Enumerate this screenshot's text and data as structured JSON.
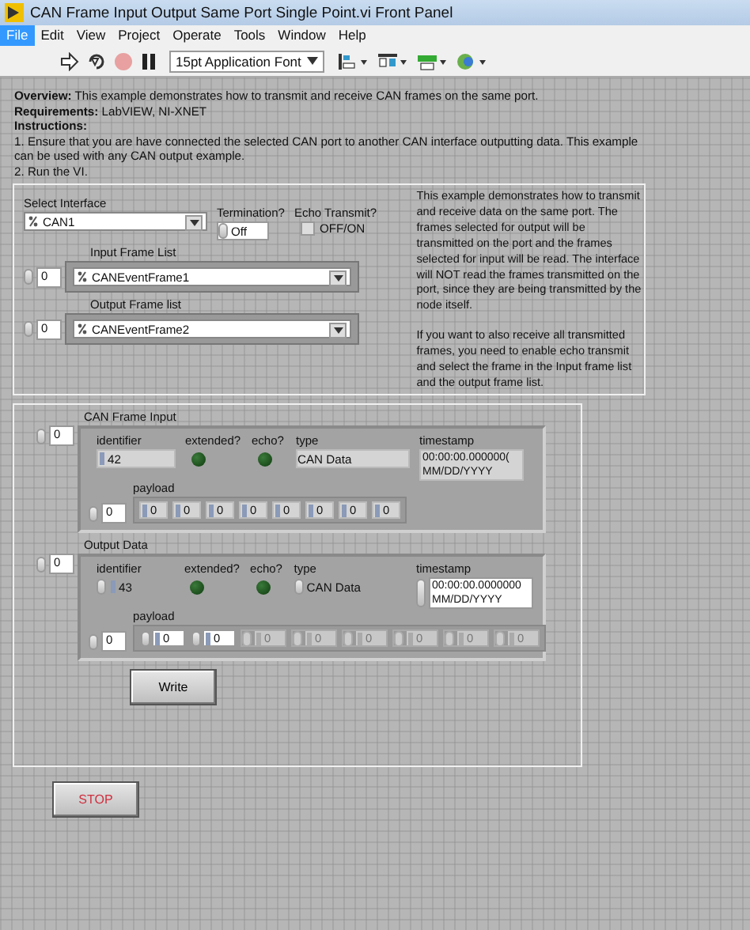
{
  "window": {
    "title": "CAN Frame Input Output Same Port Single Point.vi Front Panel"
  },
  "menu": [
    {
      "label": "File",
      "selected": true
    },
    {
      "label": "Edit",
      "selected": false
    },
    {
      "label": "View",
      "selected": false
    },
    {
      "label": "Project",
      "selected": false
    },
    {
      "label": "Operate",
      "selected": false
    },
    {
      "label": "Tools",
      "selected": false
    },
    {
      "label": "Window",
      "selected": false
    },
    {
      "label": "Help",
      "selected": false
    }
  ],
  "toolbar": {
    "font_select": "15pt Application Font"
  },
  "description": [
    "**Overview:** This example demonstrates how to transmit and receive CAN frames on the same port.",
    "**Requirements:** LabVIEW, NI-XNET",
    "**Instructions:**",
    "1. Ensure that you are have connected the selected CAN port to another CAN interface outputting data. This example can be used with any CAN output example.",
    "2.  Run the VI."
  ],
  "config": {
    "select_interface": {
      "label": "Select Interface",
      "value": "CAN1"
    },
    "termination": {
      "label": "Termination?",
      "value": "Off"
    },
    "echo_transmit": {
      "label": "Echo Transmit?",
      "checkbox_label": "OFF/ON",
      "checked": false
    },
    "frame_lists": [
      {
        "label": "Input Frame List",
        "index": "0",
        "value": "CANEventFrame1"
      },
      {
        "label": "Output Frame list",
        "index": "0",
        "value": "CANEventFrame2"
      }
    ],
    "note": [
      "This example demonstrates how to transmit and receive data on the same port.  The frames selected for output will be transmitted on the port and the frames selected for input will be read.  The interface will NOT read the frames transmitted on the port, since they are being transmitted by the node itself.",
      "If you want to also receive all transmitted frames, you need to enable echo transmit and select the frame in the Input frame list and the output frame list."
    ]
  },
  "frames": [
    {
      "kind": "indicator",
      "label": "CAN Frame Input",
      "index": "0",
      "identifier_label": "identifier",
      "identifier": "42",
      "extended_label": "extended?",
      "extended_on": false,
      "echo_label": "echo?",
      "echo_on": false,
      "type_label": "type",
      "type": "CAN Data",
      "timestamp_label": "timestamp",
      "timestamp": [
        "00:00:00.000000(",
        "MM/DD/YYYY"
      ],
      "payload_label": "payload",
      "payload_index": "0",
      "payload": [
        {
          "value": "0",
          "disabled": false
        },
        {
          "value": "0",
          "disabled": false
        },
        {
          "value": "0",
          "disabled": false
        },
        {
          "value": "0",
          "disabled": false
        },
        {
          "value": "0",
          "disabled": false
        },
        {
          "value": "0",
          "disabled": false
        },
        {
          "value": "0",
          "disabled": false
        },
        {
          "value": "0",
          "disabled": false
        }
      ]
    },
    {
      "kind": "control",
      "label": "Output Data",
      "index": "0",
      "identifier_label": "identifier",
      "identifier": "43",
      "extended_label": "extended?",
      "extended_on": false,
      "echo_label": "echo?",
      "echo_on": false,
      "type_label": "type",
      "type": "CAN Data",
      "timestamp_label": "timestamp",
      "timestamp": [
        "00:00:00.0000000",
        "MM/DD/YYYY"
      ],
      "payload_label": "payload",
      "payload_index": "0",
      "payload": [
        {
          "value": "0",
          "disabled": false
        },
        {
          "value": "0",
          "disabled": false
        },
        {
          "value": "0",
          "disabled": true
        },
        {
          "value": "0",
          "disabled": true
        },
        {
          "value": "0",
          "disabled": true
        },
        {
          "value": "0",
          "disabled": true
        },
        {
          "value": "0",
          "disabled": true
        },
        {
          "value": "0",
          "disabled": true
        }
      ]
    }
  ],
  "write_button": "Write",
  "stop_button": "STOP"
}
